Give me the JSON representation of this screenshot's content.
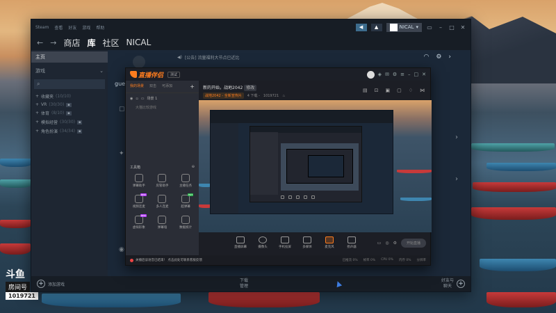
{
  "steam": {
    "menu": [
      "Steam",
      "查看",
      "好友",
      "游戏",
      "帮助"
    ],
    "user_name": "NICAL",
    "nav": [
      "商店",
      "库",
      "社区",
      "NICAL"
    ],
    "active_nav": "库",
    "sidebar": {
      "home": "主页",
      "games_header": "游戏",
      "categories": [
        {
          "label": "收藏夹",
          "count": "(10/10)"
        },
        {
          "label": "VR",
          "count": "(30/30)"
        },
        {
          "label": "体育",
          "count": "(8/10)"
        },
        {
          "label": "模拟经营",
          "count": "(30/30)"
        },
        {
          "label": "角色扮演",
          "count": "(34/34)"
        }
      ]
    },
    "notice": "[公告] 流量福利大节点已近比",
    "guest_label": "gues",
    "bottom": {
      "add_game": "添加游戏",
      "download_line1": "下载",
      "download_line2": "管理",
      "friends_line1": "好友与",
      "friends_line2": "聊天"
    }
  },
  "douyu": {
    "app_name": "直播伴侣",
    "version": "测试",
    "left_tabs": [
      "我的场景",
      "双击",
      "可添加"
    ],
    "scene_label": "场景 1",
    "scene_sub": "大猫比较游戏",
    "tools_header": "工具箱",
    "tools": [
      {
        "label": "弹幕助手",
        "badge": ""
      },
      {
        "label": "房管助手",
        "badge": ""
      },
      {
        "label": "主播任务",
        "badge": ""
      },
      {
        "label": "视频连麦",
        "badge": "NEW"
      },
      {
        "label": "多人连麦",
        "badge": ""
      },
      {
        "label": "超弹幕",
        "badge": "HOT"
      },
      {
        "label": "虚拟形象",
        "badge": "NEW"
      },
      {
        "label": "弹幕墙",
        "badge": ""
      },
      {
        "label": "数据统计",
        "badge": ""
      }
    ],
    "room_title": "新的开始，战地2042",
    "room_title_tag": "修改",
    "info_tags": [
      "战地2042 - 全新宣传片",
      "4 下载 -"
    ],
    "room_id": "1019721",
    "controls": [
      "直播屏幕",
      "摄像头",
      "手机投屏",
      "多媒体",
      "麦克风",
      "扬声器"
    ],
    "start_button": "开始直播",
    "status_warning": "关播后该语音已结束！ 点击此处可联系客服反馈",
    "stats": [
      "已推流 0%",
      "帧率 0%",
      "CPU 0%",
      "内存 0%",
      "分辨率"
    ]
  },
  "watermark": {
    "logo": "斗鱼",
    "room_label": "房间号",
    "room_id": "1019721"
  },
  "colors": {
    "steam_bg": "#1b2838",
    "douyu_accent": "#ff7d1e"
  }
}
